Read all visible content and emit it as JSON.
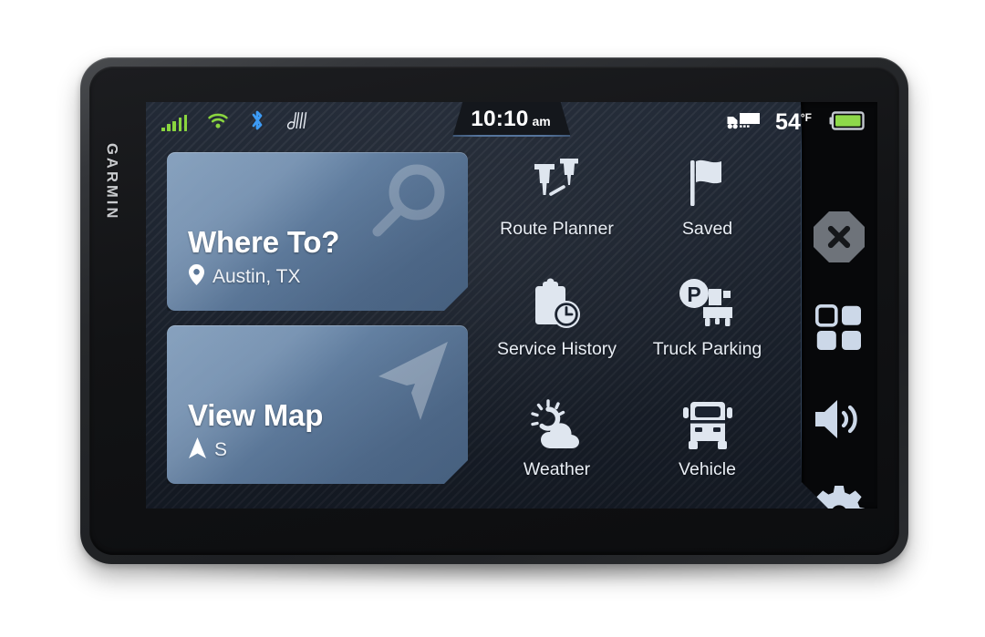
{
  "device": {
    "brand": "GARMIN"
  },
  "status_bar": {
    "signal_icon": "cellular-signal-icon",
    "signal_bars": 5,
    "wifi_icon": "wifi-icon",
    "bluetooth_icon": "bluetooth-icon",
    "dezl_icon": "dezl-logo-icon",
    "time": "10:10",
    "meridiem": "am",
    "truck_icon": "truck-trailer-icon",
    "temperature": "54",
    "temperature_unit": "°F",
    "battery_icon": "battery-full-icon",
    "colors": {
      "signal_green": "#8ad53f",
      "wifi_green": "#8ad53f",
      "bluetooth_blue": "#3d9bf5",
      "battery_green": "#8ed94a",
      "time_tab_accent": "#55749c"
    }
  },
  "cards": [
    {
      "name": "where-to",
      "title": "Where To?",
      "subtitle": "Austin, TX",
      "sub_icon": "map-pin-icon",
      "watermark_icon": "magnifier-icon"
    },
    {
      "name": "view-map",
      "title": "View Map",
      "subtitle": "S",
      "sub_icon": "navigation-arrow-icon",
      "watermark_icon": "navigation-cursor-icon"
    }
  ],
  "app_grid": [
    {
      "label": "Route Planner",
      "icon": "route-pins-icon"
    },
    {
      "label": "Saved",
      "icon": "flag-icon"
    },
    {
      "label": "Service History",
      "icon": "clipboard-clock-icon"
    },
    {
      "label": "Truck Parking",
      "icon": "truck-parking-icon"
    },
    {
      "label": "Weather",
      "icon": "sun-cloud-icon"
    },
    {
      "label": "Vehicle",
      "icon": "truck-front-icon"
    }
  ],
  "sidebar": [
    {
      "name": "close",
      "icon": "octagon-x-icon"
    },
    {
      "name": "apps",
      "icon": "apps-grid-icon"
    },
    {
      "name": "volume",
      "icon": "speaker-volume-icon"
    },
    {
      "name": "settings",
      "icon": "gear-icon"
    }
  ],
  "theme": {
    "screen_bg": "#1b2330",
    "card_blue": "#5b7798",
    "icon_white": "#dfe6ef",
    "label_text": "#e8edf4"
  }
}
